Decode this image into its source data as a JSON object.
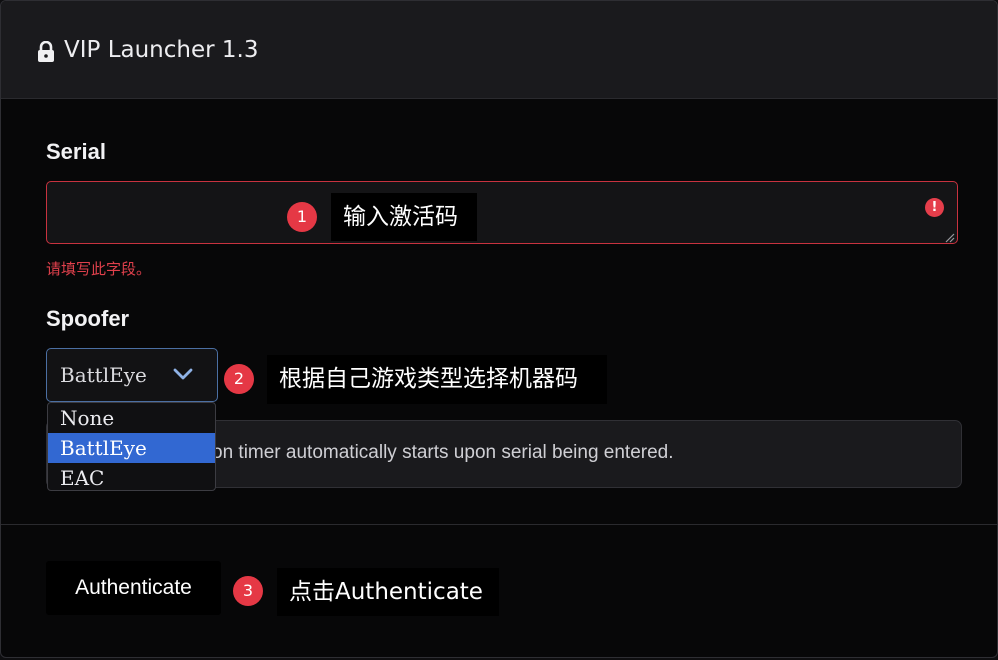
{
  "window": {
    "title": "VIP Launcher 1.3"
  },
  "serial": {
    "label": "Serial",
    "value": "",
    "validation_message": "请填写此字段。"
  },
  "spoofer": {
    "label": "Spoofer",
    "selected": "BattlEye",
    "options": [
      "None",
      "BattlEye",
      "EAC"
    ]
  },
  "info": {
    "text": "on timer automatically starts upon serial being entered."
  },
  "actions": {
    "authenticate_label": "Authenticate"
  },
  "annotations": [
    {
      "number": "1",
      "text": "输入激活码"
    },
    {
      "number": "2",
      "text": "根据自己游戏类型选择机器码"
    },
    {
      "number": "3",
      "text": "点击Authenticate"
    }
  ],
  "colors": {
    "error": "#e53e4b",
    "annotation_badge": "#e53845",
    "select_highlight": "#3268d2",
    "select_border": "#4b6fa3"
  },
  "icons": {
    "title": "lock-icon",
    "serial_error": "alert-circle-icon",
    "select": "chevron-down-icon"
  }
}
